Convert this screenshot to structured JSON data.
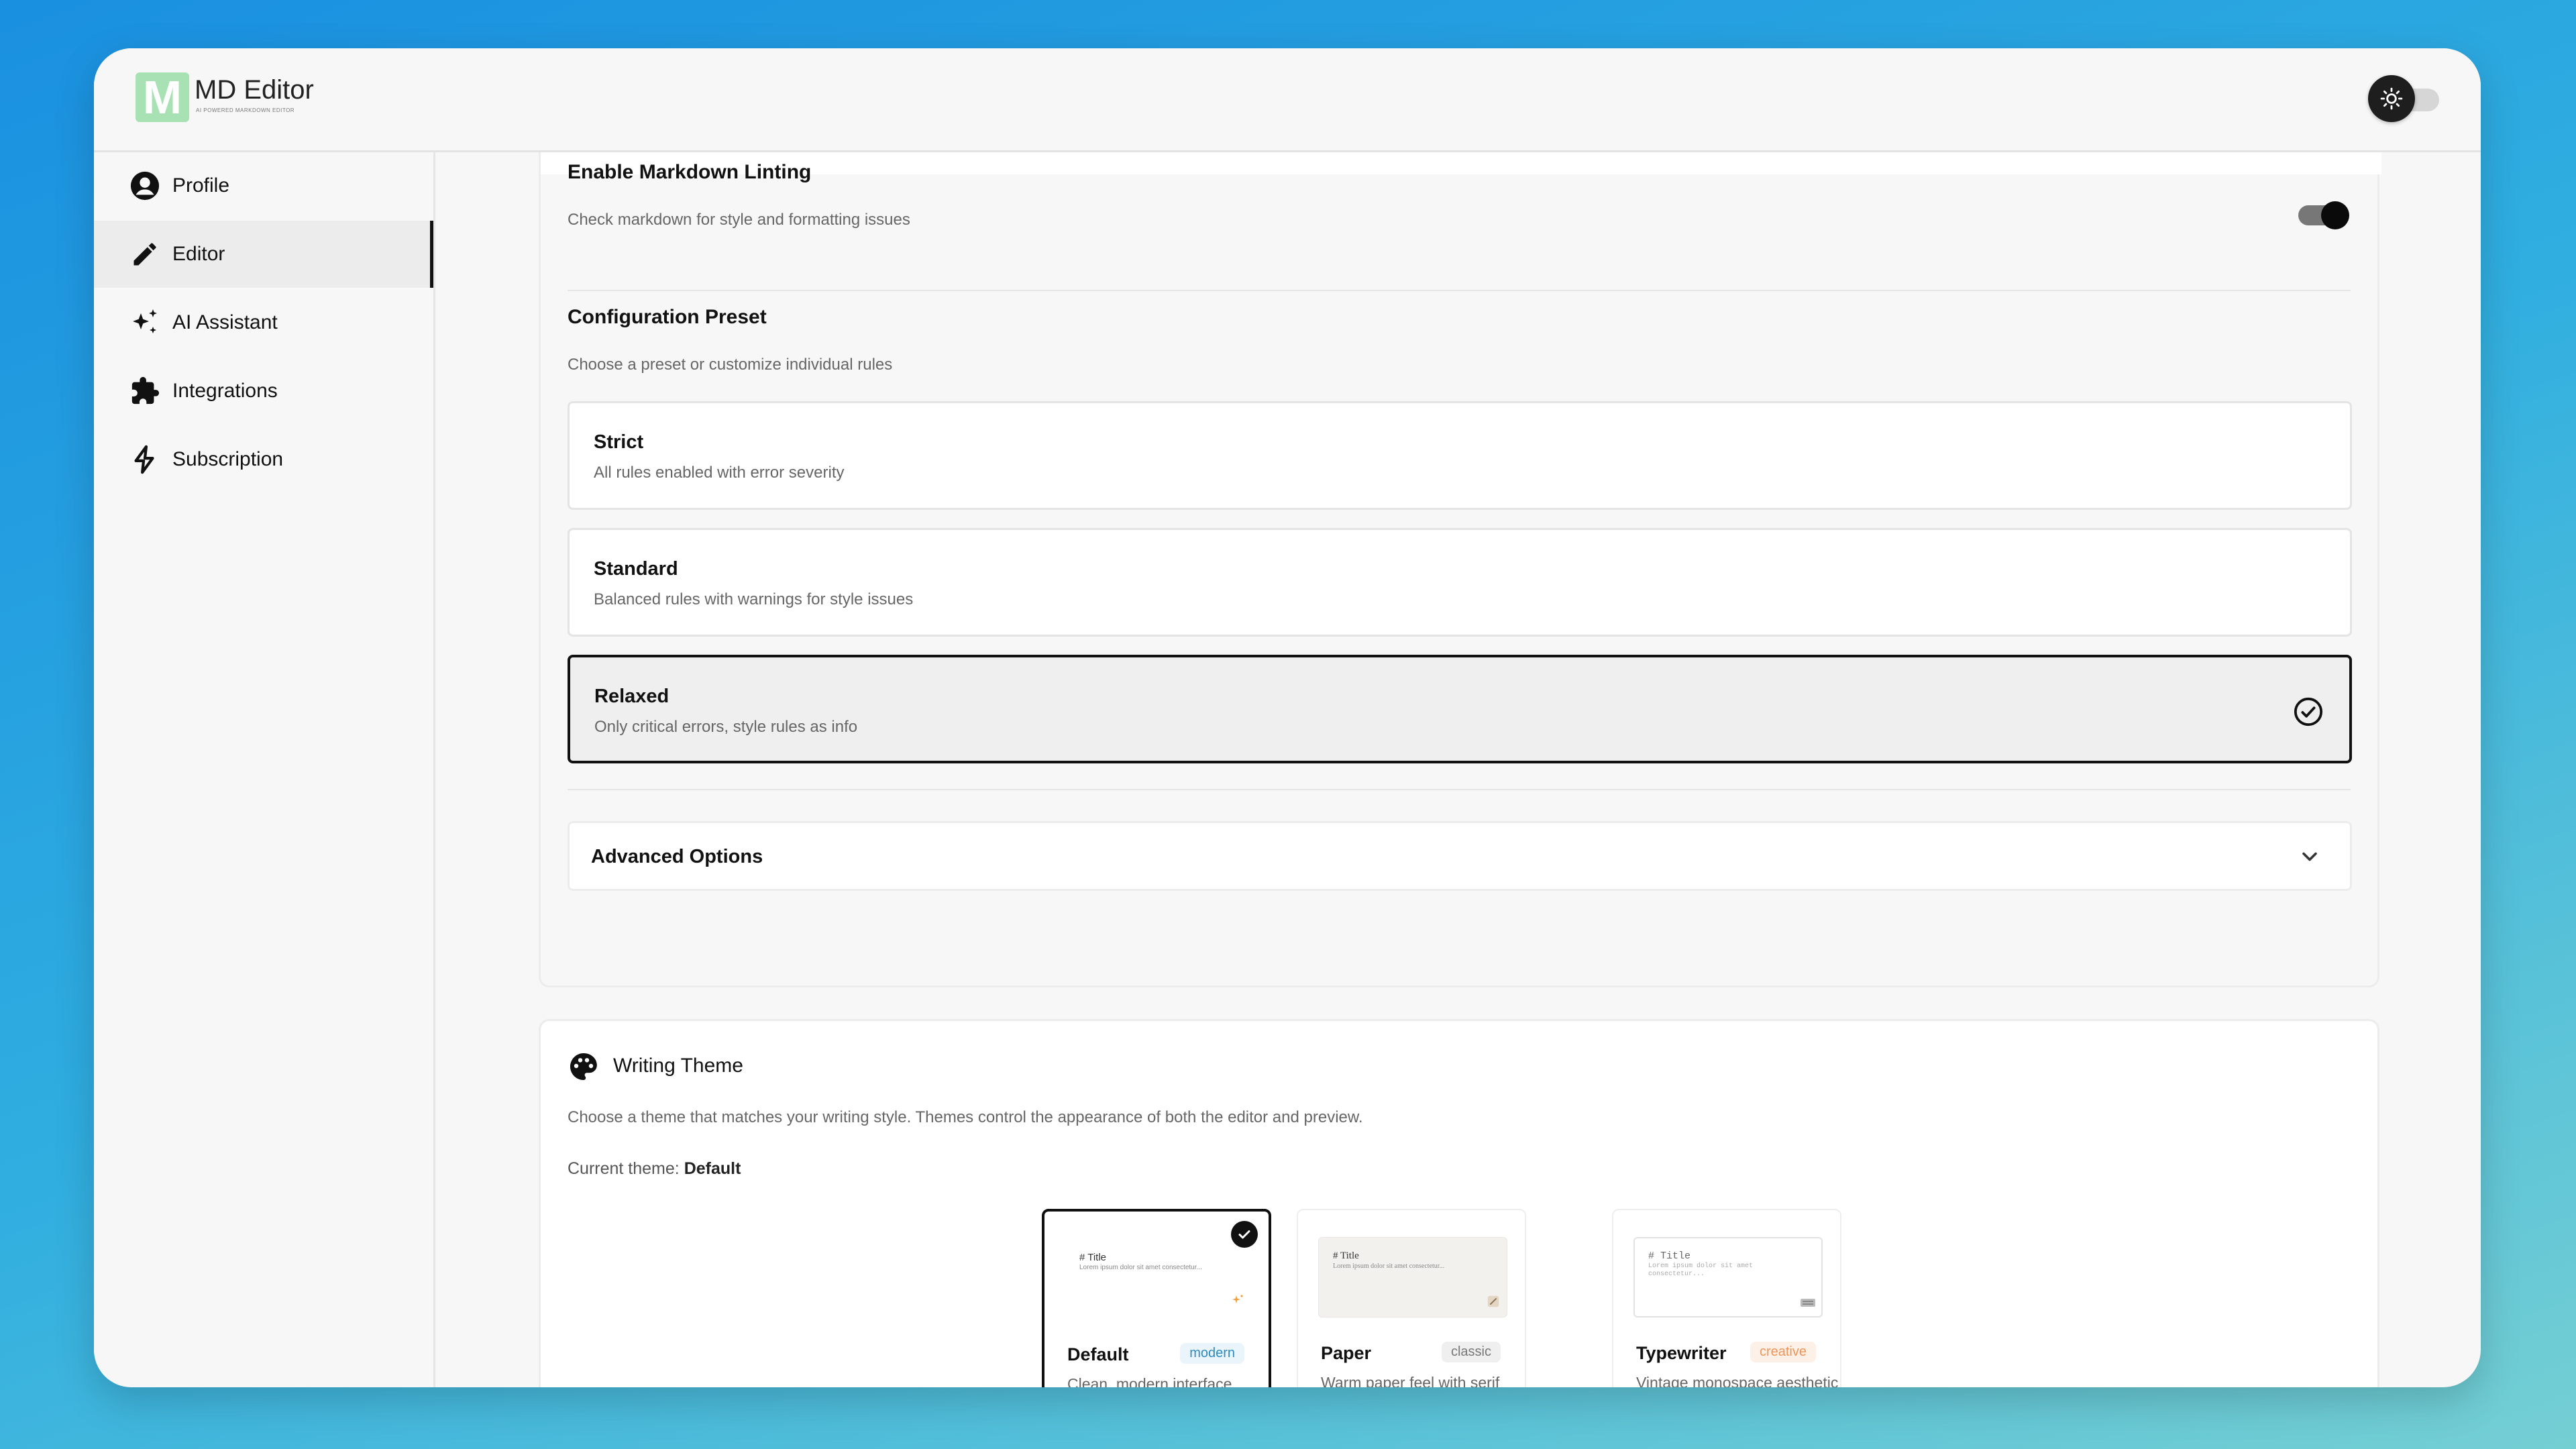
{
  "app": {
    "logo_letter": "M",
    "name": "MD Editor",
    "tagline": "AI POWERED MARKDOWN EDITOR"
  },
  "sidebar": {
    "items": [
      {
        "label": "Profile",
        "icon": "user-circle-icon"
      },
      {
        "label": "Editor",
        "icon": "pencil-icon",
        "active": true
      },
      {
        "label": "AI Assistant",
        "icon": "sparkles-icon"
      },
      {
        "label": "Integrations",
        "icon": "puzzle-icon"
      },
      {
        "label": "Subscription",
        "icon": "lightning-icon"
      }
    ]
  },
  "linting": {
    "title": "Enable Markdown Linting",
    "description": "Check markdown for style and formatting issues",
    "enabled": true
  },
  "preset": {
    "title": "Configuration Preset",
    "description": "Choose a preset or customize individual rules",
    "options": [
      {
        "title": "Strict",
        "description": "All rules enabled with error severity",
        "selected": false
      },
      {
        "title": "Standard",
        "description": "Balanced rules with warnings for style issues",
        "selected": false
      },
      {
        "title": "Relaxed",
        "description": "Only critical errors, style rules as info",
        "selected": true
      }
    ]
  },
  "advanced": {
    "title": "Advanced Options"
  },
  "writing_theme": {
    "title": "Writing Theme",
    "description": "Choose a theme that matches your writing style. Themes control the appearance of both the editor and preview.",
    "current_label": "Current theme:",
    "current_value": "Default",
    "themes": [
      {
        "name": "Default",
        "badge": "modern",
        "description": "Clean, modern interface",
        "preview_title": "# Title",
        "preview_body": "Lorem ipsum dolor sit amet consectetur...",
        "selected": true,
        "badge_color": "#2e8bc0"
      },
      {
        "name": "Paper",
        "badge": "classic",
        "description": "Warm paper feel with serif fonts",
        "preview_title": "# Title",
        "preview_body": "Lorem ipsum dolor sit amet consectetur...",
        "selected": false,
        "badge_color": "#777777"
      },
      {
        "name": "Typewriter",
        "badge": "creative",
        "description": "Vintage monospace aesthetic",
        "preview_title": "# Title",
        "preview_body": "Lorem ipsum dolor sit amet consectetur...",
        "selected": false,
        "badge_color": "#f0955a"
      }
    ]
  }
}
